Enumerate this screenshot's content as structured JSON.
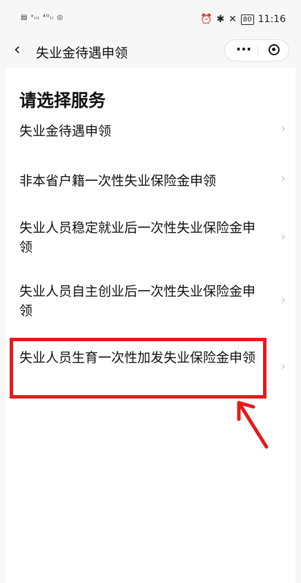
{
  "status_bar": {
    "left_indicators": "▤ ᵃᵢₗₗ ⁴ᴳₗₗ ◎",
    "icons_right": [
      "alarm-icon",
      "bluetooth-icon",
      "mute-icon"
    ],
    "battery": "80",
    "time": "11:16"
  },
  "nav": {
    "back_icon": "chevron-left-icon",
    "title": "失业金待遇申领",
    "more_icon": "···",
    "close_icon": "target-icon"
  },
  "page": {
    "heading": "请选择服务",
    "items": [
      {
        "label": "失业金待遇申领"
      },
      {
        "label": "非本省户籍一次性失业保险金申领"
      },
      {
        "label": "失业人员稳定就业后一次性失业保险金申领"
      },
      {
        "label": "失业人员自主创业后一次性失业保险金申领"
      },
      {
        "label": "失业人员生育一次性加发失业保险金申领"
      }
    ],
    "chevron": "›"
  },
  "annotation": {
    "highlight_color": "#e81919",
    "highlighted_item_index": 4
  }
}
